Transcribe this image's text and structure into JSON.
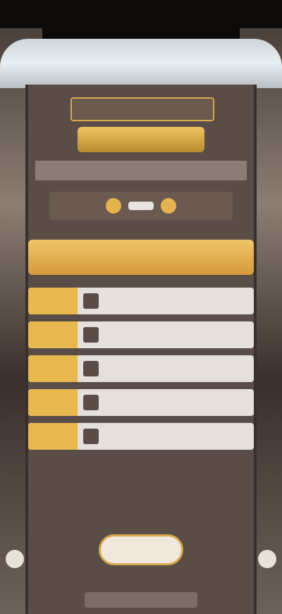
{
  "header": {
    "badge": "",
    "title": "",
    "subtitle": "",
    "player_name": ""
  },
  "table": {
    "columns": [
      "",
      "",
      ""
    ],
    "rows": [
      {
        "rank": "",
        "name": "",
        "score": ""
      },
      {
        "rank": "",
        "name": "",
        "score": ""
      },
      {
        "rank": "",
        "name": "",
        "score": ""
      },
      {
        "rank": "",
        "name": "",
        "score": ""
      },
      {
        "rank": "",
        "name": "",
        "score": ""
      }
    ]
  },
  "bottom_button": "",
  "footer_text": ""
}
